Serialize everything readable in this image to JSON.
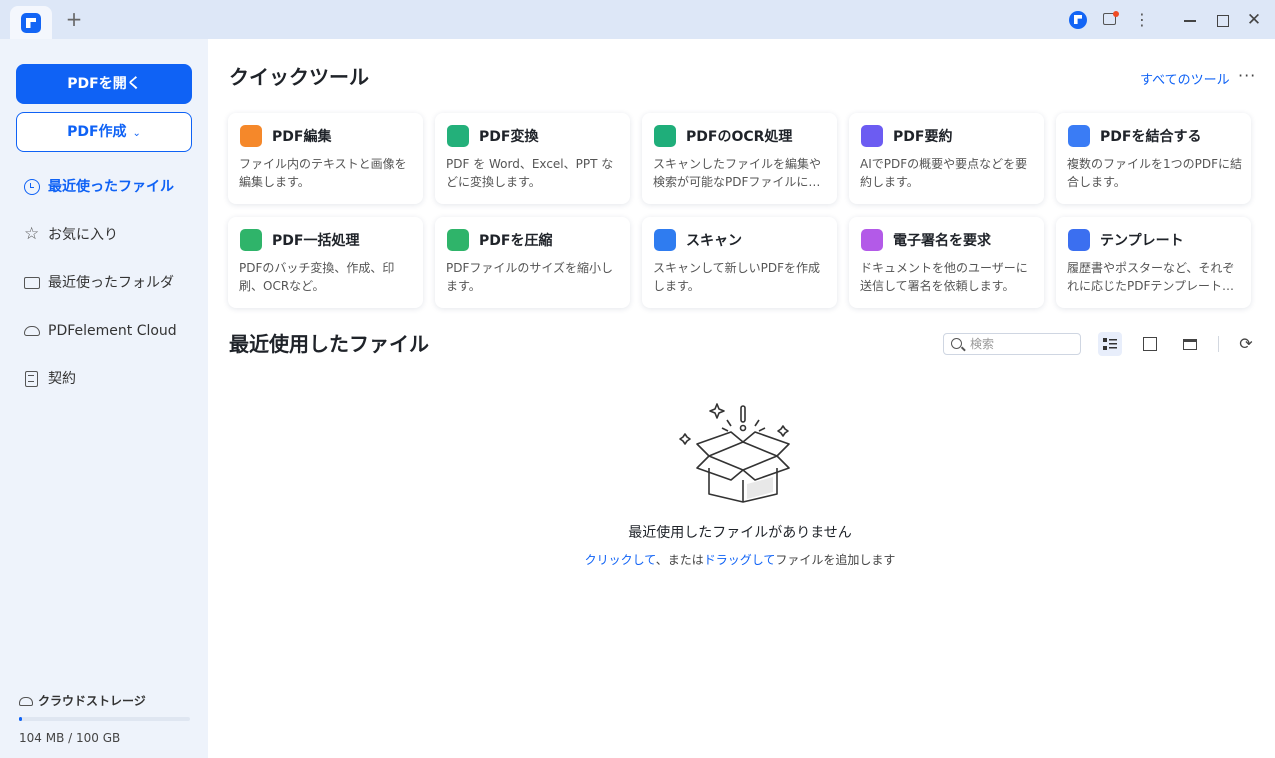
{
  "titlebar": {
    "add_tab": "+",
    "more": "⋮",
    "close": "✕"
  },
  "sidebar": {
    "open_pdf": "PDFを開く",
    "create_pdf": "PDF作成",
    "create_chevron": "⌄",
    "nav": [
      {
        "label": "最近使ったファイル",
        "icon": "clock-icon",
        "active": true
      },
      {
        "label": "お気に入り",
        "icon": "star-icon",
        "active": false
      },
      {
        "label": "最近使ったフォルダ",
        "icon": "folder-icon",
        "active": false
      },
      {
        "label": "PDFelement Cloud",
        "icon": "cloud-icon",
        "active": false
      },
      {
        "label": "契約",
        "icon": "document-icon",
        "active": false
      }
    ],
    "storage": {
      "label": "クラウドストレージ",
      "usage": "104 MB / 100 GB",
      "used_fraction": 0.001
    }
  },
  "quick_tools": {
    "title": "クイックツール",
    "all_tools": "すべてのツール",
    "more": "···",
    "cards": [
      {
        "title": "PDF編集",
        "desc": "ファイル内のテキストと画像を編集します。",
        "icon": "edit-pdf-icon",
        "color": "#f5882a"
      },
      {
        "title": "PDF変換",
        "desc": "PDF を Word、Excel、PPT などに変換します。",
        "icon": "convert-pdf-icon",
        "color": "#23b07a"
      },
      {
        "title": "PDFのOCR処理",
        "desc": "スキャンしたファイルを編集や検索が可能なPDFファイルに…",
        "icon": "ocr-icon",
        "color": "#1fae7a"
      },
      {
        "title": "PDF要約",
        "desc": "AIでPDFの概要や要点などを要約します。",
        "icon": "summary-icon",
        "color": "#6c5cf2"
      },
      {
        "title": "PDFを結合する",
        "desc": "複数のファイルを1つのPDFに結合します。",
        "icon": "merge-icon",
        "color": "#3a7cf5"
      },
      {
        "title": "PDF一括処理",
        "desc": "PDFのバッチ変換、作成、印刷、OCRなど。",
        "icon": "batch-icon",
        "color": "#2fb46a"
      },
      {
        "title": "PDFを圧縮",
        "desc": "PDFファイルのサイズを縮小します。",
        "icon": "compress-icon",
        "color": "#2fb46a"
      },
      {
        "title": "スキャン",
        "desc": "スキャンして新しいPDFを作成します。",
        "icon": "scan-icon",
        "color": "#2f7cf0"
      },
      {
        "title": "電子署名を要求",
        "desc": "ドキュメントを他のユーザーに送信して署名を依頼します。",
        "icon": "esign-icon",
        "color": "#b35ae8"
      },
      {
        "title": "テンプレート",
        "desc": "履歴書やポスターなど、それぞれに応じたPDFテンプレート…",
        "icon": "template-icon",
        "color": "#3b6ff0"
      }
    ]
  },
  "recent": {
    "title": "最近使用したファイル",
    "search_placeholder": "検索",
    "refresh": "⟳",
    "empty_title": "最近使用したファイルがありません",
    "empty_sub": {
      "link1": "クリックして",
      "mid": "、または",
      "link2": "ドラッグして",
      "tail": "ファイルを追加します"
    }
  }
}
